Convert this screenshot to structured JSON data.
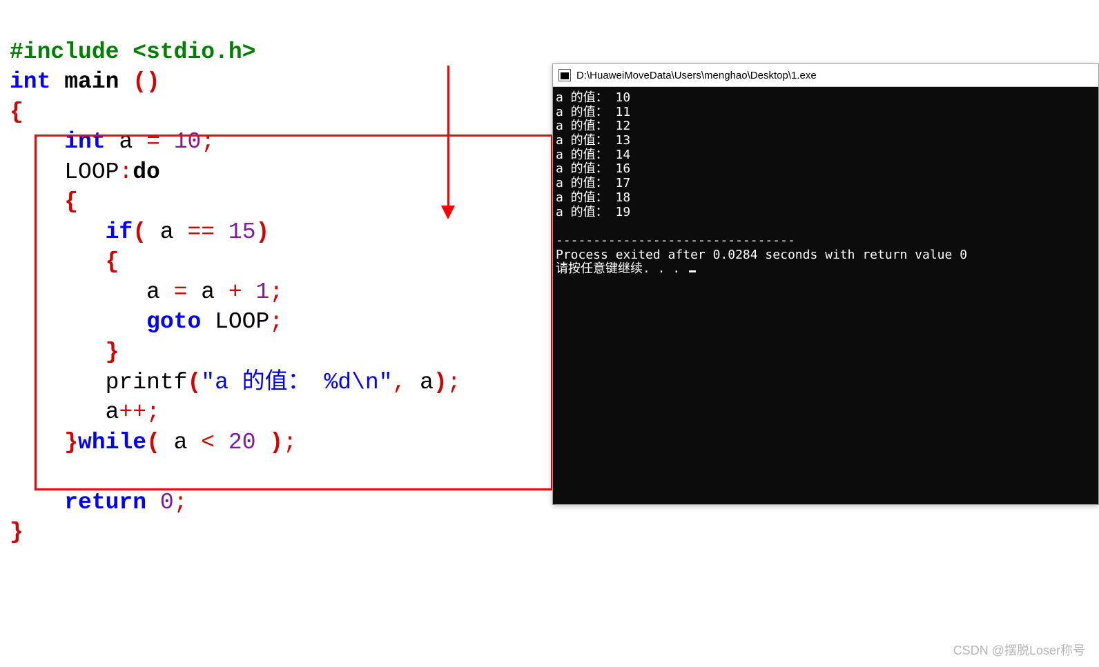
{
  "code": {
    "l1a": "#include ",
    "l1b": "<stdio.h>",
    "l2a": "int",
    "l2b": " main ",
    "l2c": "()",
    "l3": "{",
    "l4a": "    ",
    "l4b": "int",
    "l4c": " a ",
    "l4d": "=",
    "l4e": " ",
    "l4f": "10",
    "l4g": ";",
    "l5a": "    LOOP",
    "l5b": ":",
    "l5c": "do",
    "l6a": "    ",
    "l6b": "{",
    "l7a": "       ",
    "l7b": "if",
    "l7c": "(",
    "l7d": " a ",
    "l7e": "==",
    "l7f": " ",
    "l7g": "15",
    "l7h": ")",
    "l8a": "       ",
    "l8b": "{",
    "l9a": "          a ",
    "l9b": "=",
    "l9c": " a ",
    "l9d": "+",
    "l9e": " ",
    "l9f": "1",
    "l9g": ";",
    "l10a": "          ",
    "l10b": "goto",
    "l10c": " LOOP",
    "l10d": ";",
    "l11a": "       ",
    "l11b": "}",
    "l12a": "       printf",
    "l12b": "(",
    "l12c": "\"a 的值： %d\\n\"",
    "l12d": ",",
    "l12e": " a",
    "l12f": ")",
    "l12g": ";",
    "l13a": "       a",
    "l13b": "++;",
    "l14a": "    ",
    "l14b": "}",
    "l14c": "while",
    "l14d": "(",
    "l14e": " a ",
    "l14f": "<",
    "l14g": " ",
    "l14h": "20",
    "l14i": " ",
    "l14j": ")",
    "l14k": ";",
    "blank": " ",
    "l16a": "    ",
    "l16b": "return",
    "l16c": " ",
    "l16d": "0",
    "l16e": ";",
    "l17": "}"
  },
  "console": {
    "title": "D:\\HuaweiMoveData\\Users\\menghao\\Desktop\\1.exe",
    "lines": [
      "a 的值： 10",
      "a 的值： 11",
      "a 的值： 12",
      "a 的值： 13",
      "a 的值： 14",
      "a 的值： 16",
      "a 的值： 17",
      "a 的值： 18",
      "a 的值： 19",
      "",
      "--------------------------------",
      "Process exited after 0.0284 seconds with return value 0",
      "请按任意键继续. . . "
    ]
  },
  "watermark": "CSDN @摆脱Loser称号"
}
